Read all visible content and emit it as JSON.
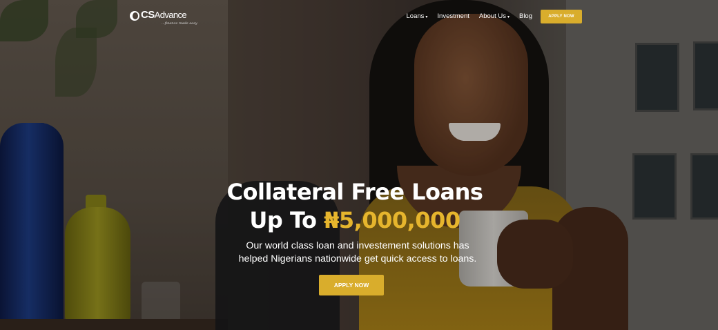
{
  "brand": {
    "name_part1": "CS",
    "name_part2": "Advance",
    "tagline": "...finance made easy"
  },
  "nav": {
    "items": [
      {
        "label": "Loans",
        "dropdown": true
      },
      {
        "label": "Investment",
        "dropdown": false
      },
      {
        "label": "About Us",
        "dropdown": true
      },
      {
        "label": "Blog",
        "dropdown": false
      }
    ],
    "cta_label": "APPLY NOW"
  },
  "hero": {
    "headline_line1": "Collateral Free Loans",
    "headline_line2_prefix": "Up To ",
    "headline_amount": "₦5,000,000",
    "subtitle_line1": "Our world class loan and investement solutions has",
    "subtitle_line2": "helped Nigerians nationwide get quick access to loans.",
    "cta_label": "APPLY NOW"
  },
  "colors": {
    "accent": "#d9ad2c",
    "amount_text": "#e6b52d",
    "text": "#ffffff"
  },
  "icons": {
    "chevron": "chevron-down-icon",
    "logo": "logo-mark-icon"
  }
}
